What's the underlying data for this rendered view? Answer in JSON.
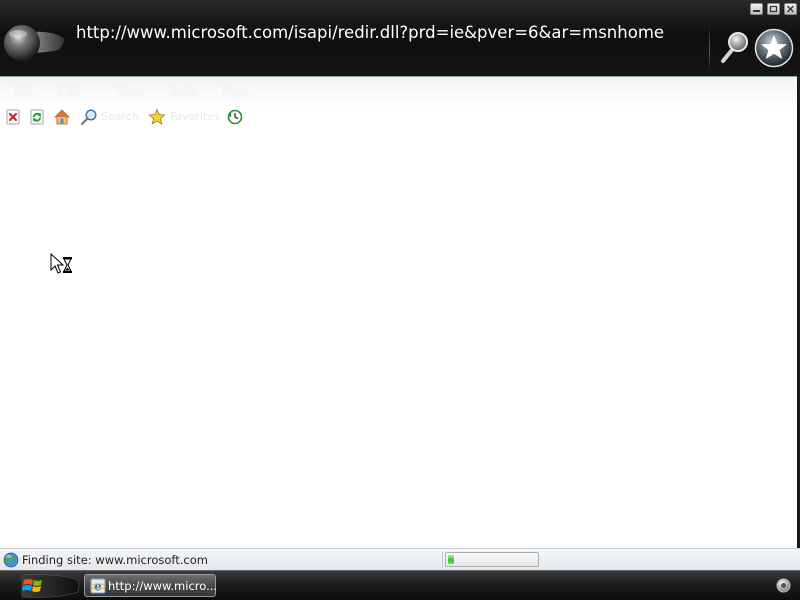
{
  "window": {
    "address_url": "http://www.microsoft.com/isapi/redir.dll?prd=ie&pver=6&ar=msnhome",
    "buttons": [
      "minimize",
      "maximize",
      "close"
    ]
  },
  "menubar": {
    "items": [
      {
        "label": "File"
      },
      {
        "label": "Edit"
      },
      {
        "label": "View"
      },
      {
        "label": "Tools"
      },
      {
        "label": "Help"
      }
    ]
  },
  "toolbar": {
    "stop_icon": "stop-icon",
    "refresh_icon": "refresh-icon",
    "home_icon": "home-icon",
    "search_label": "Search",
    "favorites_label": "Favorites",
    "history_icon": "history-icon"
  },
  "cursor": {
    "type": "busy-arrow-hourglass"
  },
  "statusbar": {
    "text": "Finding site: www.microsoft.com",
    "progress_fraction": 0.07
  },
  "taskbar": {
    "start_icon": "windows-logo-icon",
    "task_label": "http://www.micro..."
  },
  "colors": {
    "title_background": "#141414",
    "address_text": "#ffffff",
    "content_background": "#ffffff",
    "progress_fill": "#37c02c",
    "taskbar_background": "#1e1e1e"
  }
}
